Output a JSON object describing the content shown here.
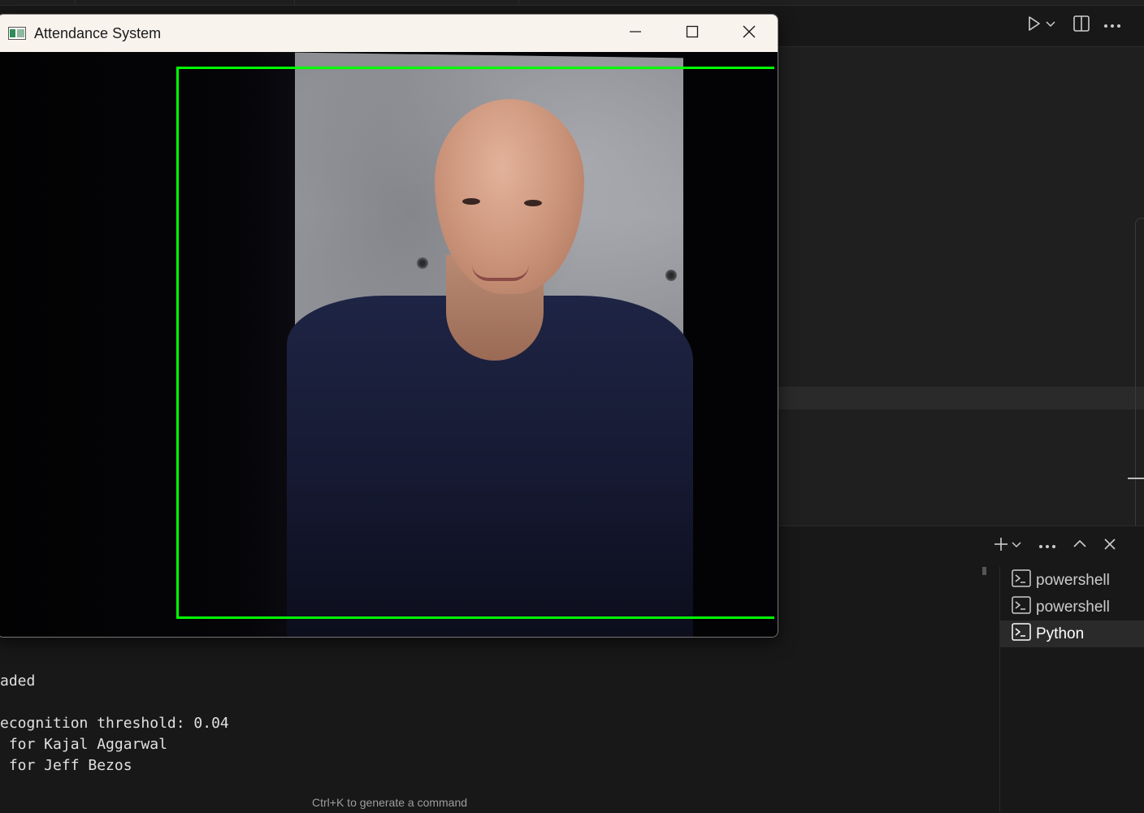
{
  "window": {
    "title": "Attendance System",
    "controls": {
      "minimize_icon": "minimize-icon",
      "maximize_icon": "maximize-icon",
      "close_icon": "close-icon"
    },
    "detection_box_color": "#00ff00"
  },
  "editor": {
    "actions": [
      "run-icon",
      "chevron-down-icon",
      "split-editor-icon",
      "more-icon"
    ]
  },
  "panel": {
    "actions": [
      "plus-icon",
      "chevron-down-icon",
      "more-icon",
      "chevron-up-icon",
      "close-icon"
    ],
    "terminals": [
      {
        "label": "powershell",
        "icon": "terminal-icon",
        "active": false
      },
      {
        "label": "powershell",
        "icon": "terminal-icon",
        "active": false
      },
      {
        "label": "Python",
        "icon": "terminal-icon",
        "active": true
      }
    ],
    "output_lines": [
      "aded",
      "",
      "ecognition threshold: 0.04",
      " for Kajal Aggarwal",
      " for Jeff Bezos"
    ],
    "hint": "Ctrl+K to generate a command"
  }
}
